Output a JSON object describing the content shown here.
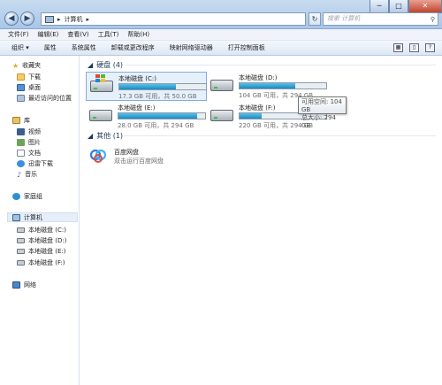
{
  "nav": {
    "back_glyph": "◀",
    "forward_glyph": "▶",
    "address_parts": [
      "计算机"
    ],
    "address_sep": "▸",
    "refresh_glyph": "↻",
    "search_placeholder": "搜索 计算机",
    "search_glyph": "⚲"
  },
  "window_buttons": {
    "minimize": "─",
    "maximize": "□",
    "close": "✕"
  },
  "menu": [
    "文件(F)",
    "编辑(E)",
    "查看(V)",
    "工具(T)",
    "帮助(H)"
  ],
  "toolbar": {
    "items": [
      "组织 ▾",
      "属性",
      "系统属性",
      "卸载或更改程序",
      "映射网络驱动器",
      "打开控制面板"
    ],
    "right_icons": [
      "view-icon",
      "preview-pane-icon",
      "help-icon"
    ]
  },
  "sidebar": {
    "favorites": {
      "label": "收藏夹",
      "items": [
        "下载",
        "桌面",
        "最近访问的位置"
      ]
    },
    "libraries": {
      "label": "库",
      "items": [
        "视频",
        "图片",
        "文档",
        "迅雷下载",
        "音乐"
      ]
    },
    "homegroup": "家庭组",
    "computer": {
      "label": "计算机",
      "items": [
        "本地磁盘 (C:)",
        "本地磁盘 (D:)",
        "本地磁盘 (E:)",
        "本地磁盘 (F:)"
      ]
    },
    "network": "网络"
  },
  "groups": {
    "drives": {
      "label": "硬盘 (4)",
      "toggle": "◢"
    },
    "other": {
      "label": "其他 (1)",
      "toggle": "◢"
    }
  },
  "drives": [
    {
      "name": "本地磁盘 (C:)",
      "size": "17.3 GB 可用，共 50.0 GB",
      "used_fraction": 0.654,
      "system": true,
      "selected": true
    },
    {
      "name": "本地磁盘 (D:)",
      "size": "104 GB 可用，共 294 GB",
      "used_fraction": 0.646,
      "system": false,
      "selected": false
    },
    {
      "name": "本地磁盘 (E:)",
      "size": "28.0 GB 可用，共 294 GB",
      "used_fraction": 0.905,
      "system": false,
      "selected": false
    },
    {
      "name": "本地磁盘 (F:)",
      "size": "220 GB 可用，共 294 GB",
      "used_fraction": 0.252,
      "system": false,
      "selected": false
    }
  ],
  "tooltip": {
    "line1": "可用空间: 104 GB",
    "line2": "总大小: 294 GB"
  },
  "other_items": [
    {
      "name": "百度网盘",
      "desc": "双击运行百度网盘"
    }
  ],
  "colors": {
    "accent": "#1a8ac2",
    "title_bg": "#b9d1ea",
    "selection": "#e5f0fb"
  }
}
